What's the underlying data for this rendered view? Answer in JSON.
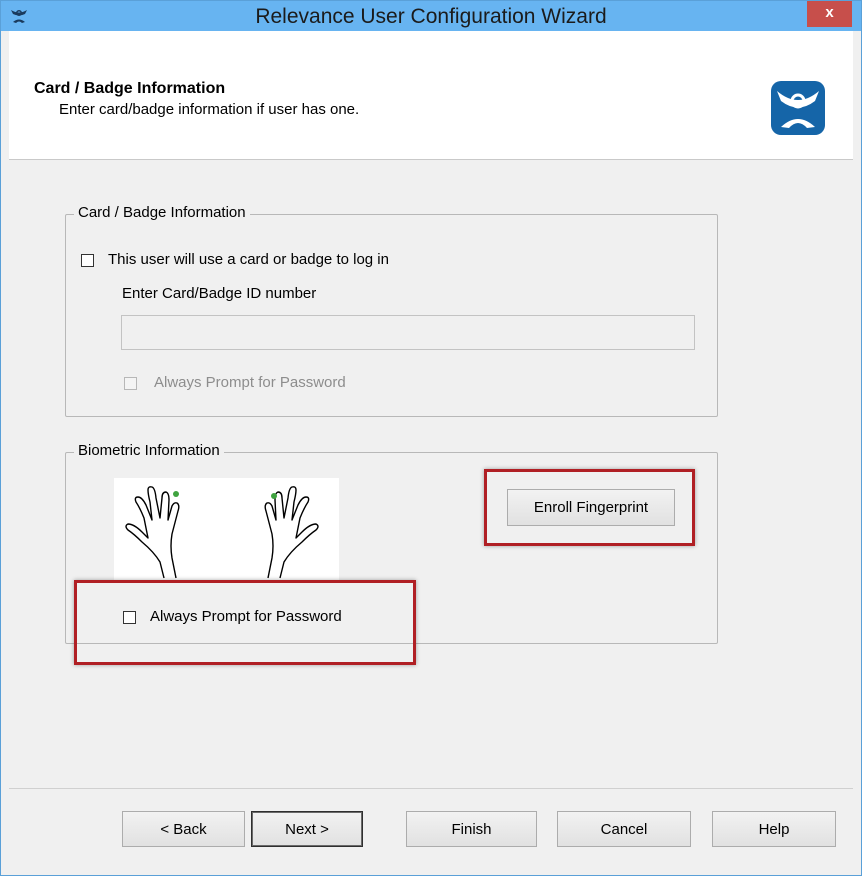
{
  "window": {
    "title": "Relevance User Configuration Wizard",
    "close_glyph": "x",
    "app_icon": "thinmanager-icon"
  },
  "header": {
    "title": "Card / Badge Information",
    "subtitle": "Enter card/badge information if user has one.",
    "logo_icon": "thinmanager-logo"
  },
  "card_group": {
    "legend": "Card / Badge Information",
    "use_card_label": "This user will use a card or badge to log in",
    "use_card_checked": false,
    "id_label": "Enter Card/Badge ID number",
    "id_value": "",
    "prompt_password_label": "Always Prompt for Password",
    "prompt_password_checked": false,
    "prompt_password_enabled": false
  },
  "biometric_group": {
    "legend": "Biometric Information",
    "enroll_button": "Enroll Fingerprint",
    "prompt_password_label": "Always Prompt for Password",
    "prompt_password_checked": false,
    "hands_icon": "fingerprint-hands"
  },
  "buttons": {
    "back": "< Back",
    "next": "Next >",
    "finish": "Finish",
    "cancel": "Cancel",
    "help": "Help"
  },
  "colors": {
    "titlebar": "#67b4f1",
    "close_button": "#c74f4b",
    "highlight_box": "#b01f24",
    "logo": "#1565a8",
    "finger_marker": "#3fa33f"
  }
}
